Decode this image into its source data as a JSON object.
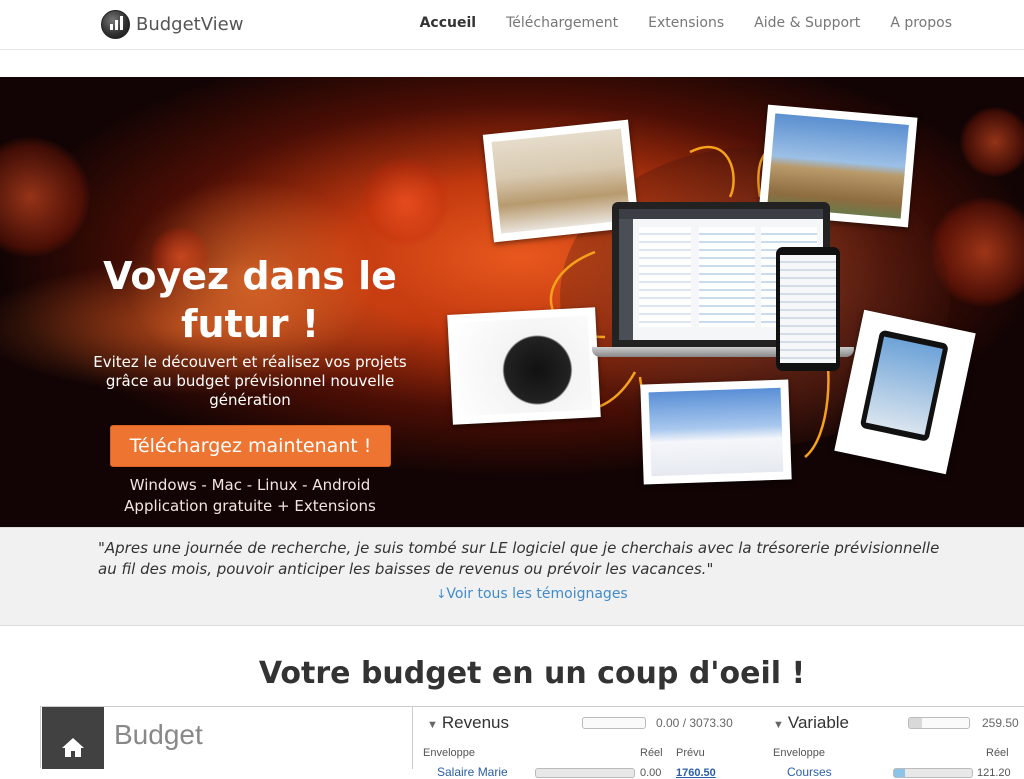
{
  "brand": {
    "name": "BudgetView",
    "icon": "budget-chart-logo-icon"
  },
  "nav": {
    "items": [
      {
        "label": "Accueil",
        "active": true
      },
      {
        "label": "Téléchargement",
        "active": false
      },
      {
        "label": "Extensions",
        "active": false
      },
      {
        "label": "Aide & Support",
        "active": false
      },
      {
        "label": "A propos",
        "active": false
      }
    ]
  },
  "hero": {
    "title": "Voyez dans le futur !",
    "subtitle": "Evitez le découvert et réalisez vos projets grâce au budget prévisionnel nouvelle génération",
    "cta_label": "Téléchargez maintenant !",
    "platforms": "Windows - Mac - Linux - Android",
    "pricing": "Application gratuite + Extensions",
    "accent_color": "#ee7531"
  },
  "testimonial": {
    "quote": "\"Apres une journée de recherche, je suis tombé sur LE logiciel que je cherchais avec la trésorerie prévisionnelle au fil des mois, pouvoir anticiper les baisses de revenus ou prévoir les vacances.\"",
    "link_label": "Voir tous les témoignages",
    "link_icon": "arrow-down-icon",
    "link_color": "#428bca"
  },
  "overview": {
    "title": "Votre budget en un coup d'oeil !",
    "budget_label": "Budget",
    "home_icon": "home-icon",
    "revenus": {
      "title": "Revenus",
      "actual": "0.00",
      "planned": "3073.30",
      "col_envelope": "Enveloppe",
      "col_actual": "Réel",
      "col_planned": "Prévu",
      "first_row_label": "Salaire Marie",
      "first_row_actual": "0.00",
      "first_row_planned": "1760.50"
    },
    "variable": {
      "title": "Variable",
      "actual": "259.50",
      "col_envelope": "Enveloppe",
      "col_actual": "Réel",
      "first_row_label": "Courses",
      "first_row_actual": "121.20"
    }
  }
}
